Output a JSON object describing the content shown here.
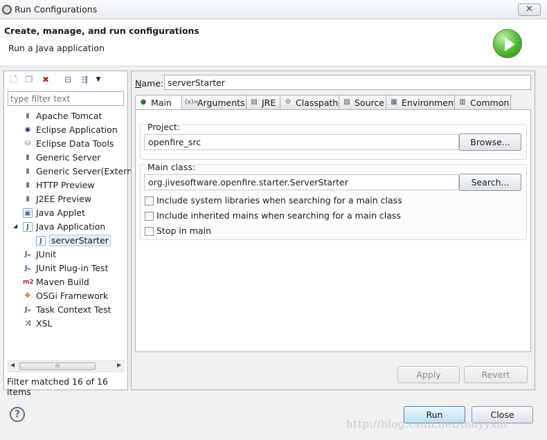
{
  "window": {
    "title": "Run Configurations",
    "close_glyph": "✕"
  },
  "header": {
    "title": "Create, manage, and run configurations",
    "subtitle": "Run a Java application"
  },
  "left": {
    "filter_placeholder": "type filter text",
    "tree": [
      {
        "label": "Apache Tomcat",
        "icon": "server-icon"
      },
      {
        "label": "Eclipse Application",
        "icon": "eclipse-icon"
      },
      {
        "label": "Eclipse Data Tools",
        "icon": "database-icon"
      },
      {
        "label": "Generic Server",
        "icon": "server-icon"
      },
      {
        "label": "Generic Server(Extern",
        "icon": "server-icon"
      },
      {
        "label": "HTTP Preview",
        "icon": "server-icon"
      },
      {
        "label": "J2EE Preview",
        "icon": "server-icon"
      },
      {
        "label": "Java Applet",
        "icon": "applet-icon"
      },
      {
        "label": "Java Application",
        "icon": "java-app-icon"
      },
      {
        "label": "serverStarter",
        "icon": "java-app-icon"
      },
      {
        "label": "JUnit",
        "icon": "junit-icon"
      },
      {
        "label": "JUnit Plug-in Test",
        "icon": "junit-plugin-icon"
      },
      {
        "label": "Maven Build",
        "icon": "maven-icon"
      },
      {
        "label": "OSGi Framework",
        "icon": "osgi-icon"
      },
      {
        "label": "Task Context Test",
        "icon": "junit-icon"
      },
      {
        "label": "XSL",
        "icon": "xsl-icon"
      }
    ],
    "status": "Filter matched 16 of 16 items",
    "scroll_thumb": "III"
  },
  "right": {
    "name_label": "Name:",
    "name_value": "serverStarter",
    "tabs": [
      {
        "label": "Main",
        "icon": "main-tab-icon"
      },
      {
        "label": "Arguments",
        "icon": "arguments-icon"
      },
      {
        "label": "JRE",
        "icon": "jre-icon"
      },
      {
        "label": "Classpath",
        "icon": "classpath-icon"
      },
      {
        "label": "Source",
        "icon": "source-icon"
      },
      {
        "label": "Environment",
        "icon": "environment-icon"
      },
      {
        "label": "Common",
        "icon": "common-icon"
      }
    ],
    "project_label": "Project:",
    "project_value": "openfire_src",
    "browse_label": "Browse...",
    "main_class_label": "Main class:",
    "main_class_value": "org.jivesoftware.openfire.starter.ServerStarter",
    "search_label": "Search...",
    "checks": [
      {
        "label": "Include system libraries when searching for a main class",
        "checked": false
      },
      {
        "label": "Include inherited mains when searching for a main class",
        "checked": false
      },
      {
        "label": "Stop in main",
        "checked": false
      }
    ],
    "apply_label": "Apply",
    "revert_label": "Revert"
  },
  "footer": {
    "run_label": "Run",
    "close_label": "Close",
    "help_glyph": "?",
    "watermark": "http://blog.csdn.net/tonyyxm"
  }
}
